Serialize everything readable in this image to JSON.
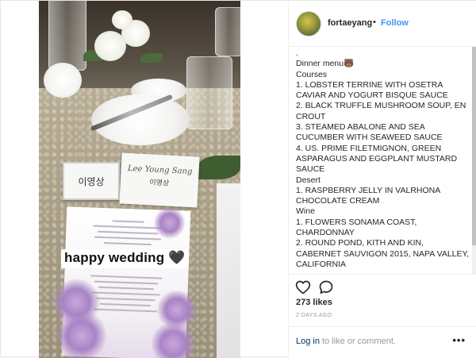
{
  "post": {
    "story_text": "happy wedding 🖤",
    "place_card_korean": "이영상",
    "place_card_script": "Lee Young Sang",
    "place_card_script_korean": "이영상"
  },
  "header": {
    "username": "fortaeyang",
    "separator": "•",
    "follow_label": "Follow"
  },
  "caption": {
    "lines": [
      ".",
      "Dinner menu🐻",
      "Courses",
      "1. LOBSTER TERRINE WITH OSETRA CAVIAR AND YOGURT BISQUE SAUCE",
      "2. BLACK TRUFFLE MUSHROOM SOUP, EN CROUT",
      "3. STEAMED ABALONE AND SEA CUCUMBER WITH SEAWEED SAUCE",
      "4. US. PRIME FILETMIGNON, GREEN ASPARAGUS AND EGGPLANT MUSTARD SAUCE",
      "Desert",
      "1. RASPBERRY JELLY IN VALRHONA CHOCOLATE CREAM",
      "Wine",
      "1. FLOWERS SONAMA COAST, CHARDONNAY",
      "2. ROUND POND, KITH AND KIN, CABERNET SAUVIGON 2015, NAPA VALLEY, CALIFORNIA"
    ]
  },
  "actions": {
    "like_icon": "heart-outline-icon",
    "comment_icon": "speech-bubble-icon"
  },
  "likes_text": "273 likes",
  "date_text": "2 DAYS AGO",
  "footer": {
    "login_link": "Log in",
    "login_rest": " to like or comment.",
    "more_label": "•••"
  },
  "colors": {
    "link_blue": "#3897f0",
    "login_blue": "#003569",
    "text": "#262626",
    "muted": "#999999",
    "border": "#efefef"
  }
}
